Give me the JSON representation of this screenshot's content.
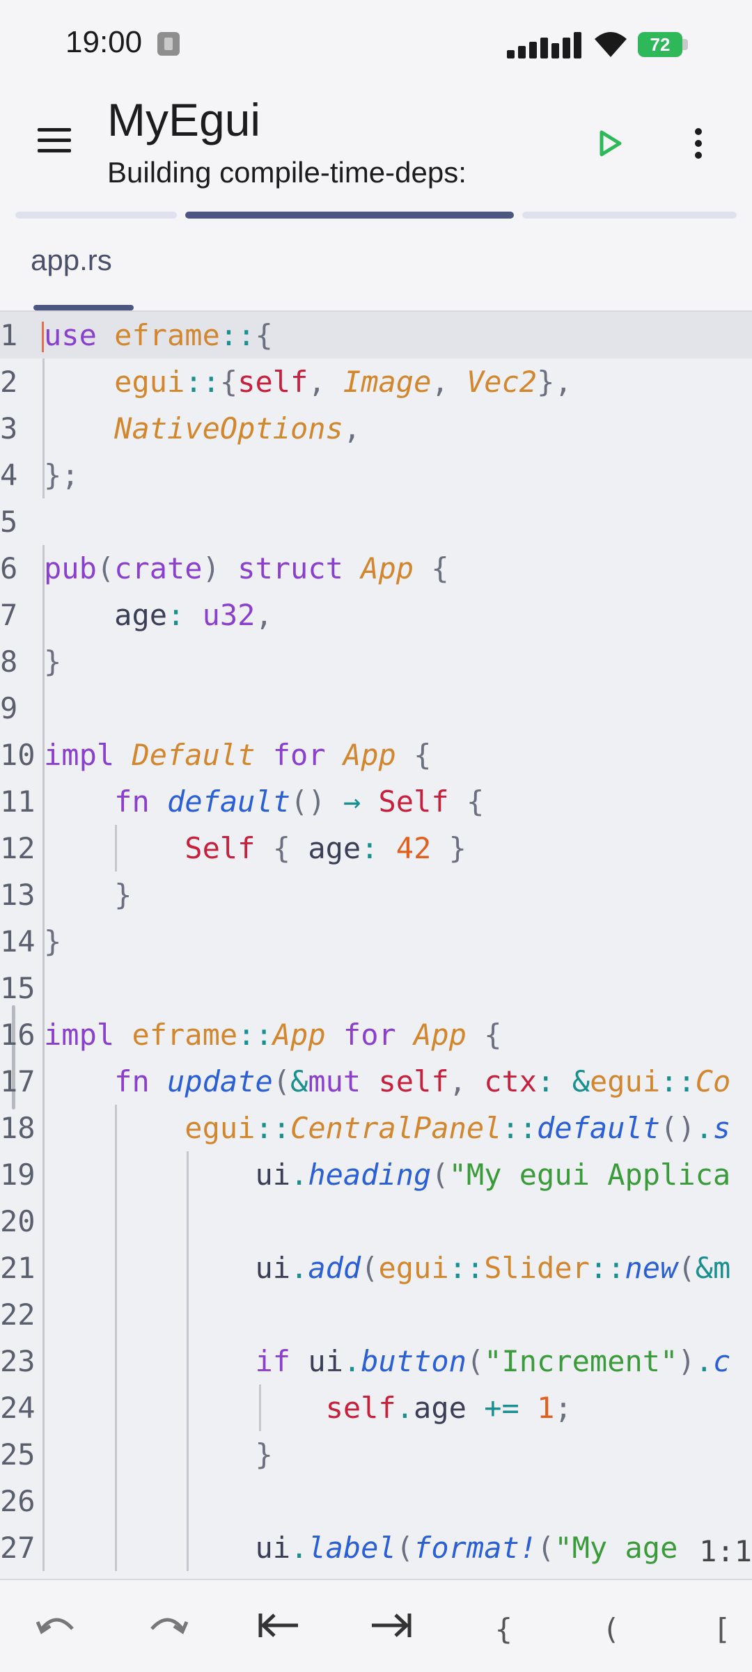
{
  "status_bar": {
    "time": "19:00",
    "battery": "72"
  },
  "app_bar": {
    "title": "MyEgui",
    "subtitle": "Building compile-time-deps:"
  },
  "icons": {
    "menu": "hamburger-menu-icon",
    "run": "play-icon",
    "more": "more-vert-icon",
    "undo": "undo-icon",
    "redo": "redo-icon",
    "tab_left": "tab-left-icon",
    "tab_right": "tab-right-icon"
  },
  "colors": {
    "accent": "#4c5680",
    "run_green": "#2fb85a"
  },
  "progress": {
    "active_segment": 2,
    "segments": 3
  },
  "tabs": [
    {
      "label": "app.rs"
    }
  ],
  "editor": {
    "cursor_position": "1:1",
    "line_numbers": [
      "1",
      "2",
      "3",
      "4",
      "5",
      "6",
      "7",
      "8",
      "9",
      "10",
      "11",
      "12",
      "13",
      "14",
      "15",
      "16",
      "17",
      "18",
      "19",
      "20",
      "21",
      "22",
      "23",
      "24",
      "25",
      "26",
      "27"
    ],
    "lines": [
      [
        [
          "kw",
          "use"
        ],
        [
          "pt",
          " "
        ],
        [
          "md",
          "eframe"
        ],
        [
          "op",
          "::"
        ],
        [
          "pu",
          "{"
        ]
      ],
      [
        [
          "pt",
          "    "
        ],
        [
          "md",
          "egui"
        ],
        [
          "op",
          "::"
        ],
        [
          "pu",
          "{"
        ],
        [
          "sf",
          "self"
        ],
        [
          "pu",
          ", "
        ],
        [
          "ty",
          "Image"
        ],
        [
          "pu",
          ", "
        ],
        [
          "ty",
          "Vec2"
        ],
        [
          "pu",
          "},"
        ]
      ],
      [
        [
          "pt",
          "    "
        ],
        [
          "ty",
          "NativeOptions"
        ],
        [
          "pu",
          ","
        ]
      ],
      [
        [
          "pu",
          "};"
        ]
      ],
      [],
      [
        [
          "kw",
          "pub"
        ],
        [
          "pu",
          "("
        ],
        [
          "kw",
          "crate"
        ],
        [
          "pu",
          ")"
        ],
        [
          "pt",
          " "
        ],
        [
          "kw",
          "struct"
        ],
        [
          "pt",
          " "
        ],
        [
          "ty",
          "App"
        ],
        [
          "pt",
          " "
        ],
        [
          "pu",
          "{"
        ]
      ],
      [
        [
          "pt",
          "    "
        ],
        [
          "id",
          "age"
        ],
        [
          "op",
          ":"
        ],
        [
          "pt",
          " "
        ],
        [
          "kw",
          "u32"
        ],
        [
          "pu",
          ","
        ]
      ],
      [
        [
          "pu",
          "}"
        ]
      ],
      [],
      [
        [
          "kw",
          "impl"
        ],
        [
          "pt",
          " "
        ],
        [
          "ty",
          "Default"
        ],
        [
          "pt",
          " "
        ],
        [
          "kw",
          "for"
        ],
        [
          "pt",
          " "
        ],
        [
          "ty",
          "App"
        ],
        [
          "pt",
          " "
        ],
        [
          "pu",
          "{"
        ]
      ],
      [
        [
          "pt",
          "    "
        ],
        [
          "kw",
          "fn"
        ],
        [
          "pt",
          " "
        ],
        [
          "fn",
          "default"
        ],
        [
          "pu",
          "()"
        ],
        [
          "pt",
          " "
        ],
        [
          "op",
          "→"
        ],
        [
          "pt",
          " "
        ],
        [
          "sf",
          "Self"
        ],
        [
          "pt",
          " "
        ],
        [
          "pu",
          "{"
        ]
      ],
      [
        [
          "pt",
          "        "
        ],
        [
          "sf",
          "Self"
        ],
        [
          "pt",
          " "
        ],
        [
          "pu",
          "{"
        ],
        [
          "pt",
          " "
        ],
        [
          "id",
          "age"
        ],
        [
          "op",
          ":"
        ],
        [
          "pt",
          " "
        ],
        [
          "nu",
          "42"
        ],
        [
          "pt",
          " "
        ],
        [
          "pu",
          "}"
        ]
      ],
      [
        [
          "pt",
          "    "
        ],
        [
          "pu",
          "}"
        ]
      ],
      [
        [
          "pu",
          "}"
        ]
      ],
      [],
      [
        [
          "kw",
          "impl"
        ],
        [
          "pt",
          " "
        ],
        [
          "md",
          "eframe"
        ],
        [
          "op",
          "::"
        ],
        [
          "ty",
          "App"
        ],
        [
          "pt",
          " "
        ],
        [
          "kw",
          "for"
        ],
        [
          "pt",
          " "
        ],
        [
          "ty",
          "App"
        ],
        [
          "pt",
          " "
        ],
        [
          "pu",
          "{"
        ]
      ],
      [
        [
          "pt",
          "    "
        ],
        [
          "kw",
          "fn"
        ],
        [
          "pt",
          " "
        ],
        [
          "fn",
          "update"
        ],
        [
          "pu",
          "("
        ],
        [
          "op",
          "&"
        ],
        [
          "kw",
          "mut"
        ],
        [
          "pt",
          " "
        ],
        [
          "sf",
          "self"
        ],
        [
          "pu",
          ", "
        ],
        [
          "sf",
          "ctx"
        ],
        [
          "op",
          ":"
        ],
        [
          "pt",
          " "
        ],
        [
          "op",
          "&"
        ],
        [
          "md",
          "egui"
        ],
        [
          "op",
          "::"
        ],
        [
          "ty",
          "Co"
        ]
      ],
      [
        [
          "pt",
          "        "
        ],
        [
          "md",
          "egui"
        ],
        [
          "op",
          "::"
        ],
        [
          "ty",
          "CentralPanel"
        ],
        [
          "op",
          "::"
        ],
        [
          "fn",
          "default"
        ],
        [
          "pu",
          "()"
        ],
        [
          "op",
          "."
        ],
        [
          "fn",
          "s"
        ]
      ],
      [
        [
          "pt",
          "            "
        ],
        [
          "id",
          "ui"
        ],
        [
          "op",
          "."
        ],
        [
          "fn",
          "heading"
        ],
        [
          "pu",
          "("
        ],
        [
          "st",
          "\"My egui Applica"
        ]
      ],
      [],
      [
        [
          "pt",
          "            "
        ],
        [
          "id",
          "ui"
        ],
        [
          "op",
          "."
        ],
        [
          "fn",
          "add"
        ],
        [
          "pu",
          "("
        ],
        [
          "md",
          "egui"
        ],
        [
          "op",
          "::"
        ],
        [
          "md",
          "Slider"
        ],
        [
          "op",
          "::"
        ],
        [
          "fn",
          "new"
        ],
        [
          "pu",
          "("
        ],
        [
          "op",
          "&m"
        ]
      ],
      [],
      [
        [
          "pt",
          "            "
        ],
        [
          "kw",
          "if"
        ],
        [
          "pt",
          " "
        ],
        [
          "id",
          "ui"
        ],
        [
          "op",
          "."
        ],
        [
          "fn",
          "button"
        ],
        [
          "pu",
          "("
        ],
        [
          "st",
          "\"Increment\""
        ],
        [
          "pu",
          ")"
        ],
        [
          "op",
          "."
        ],
        [
          "fn",
          "c"
        ]
      ],
      [
        [
          "pt",
          "                "
        ],
        [
          "sf",
          "self"
        ],
        [
          "op",
          "."
        ],
        [
          "id",
          "age"
        ],
        [
          "pt",
          " "
        ],
        [
          "op",
          "+="
        ],
        [
          "pt",
          " "
        ],
        [
          "nu",
          "1"
        ],
        [
          "pu",
          ";"
        ]
      ],
      [
        [
          "pt",
          "            "
        ],
        [
          "pu",
          "}"
        ]
      ],
      [],
      [
        [
          "pt",
          "            "
        ],
        [
          "id",
          "ui"
        ],
        [
          "op",
          "."
        ],
        [
          "fn",
          "label"
        ],
        [
          "pu",
          "("
        ],
        [
          "fn",
          "format!"
        ],
        [
          "pu",
          "("
        ],
        [
          "st",
          "\"My age"
        ]
      ]
    ]
  },
  "bottom_bar": {
    "brace": "{",
    "paren": "(",
    "bracket": "["
  }
}
